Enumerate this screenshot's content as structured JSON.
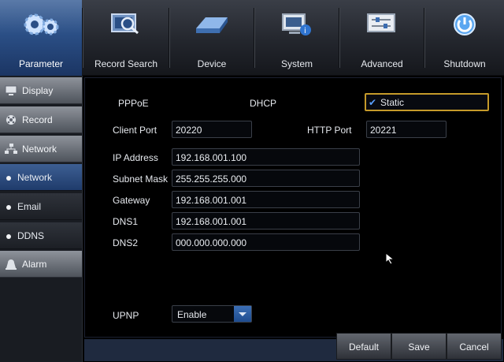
{
  "topnav": {
    "tabs": [
      {
        "label": "Parameter",
        "icon": "gear-icon",
        "active": true
      },
      {
        "label": "Record Search",
        "icon": "search-icon",
        "active": false
      },
      {
        "label": "Device",
        "icon": "hard-disk-icon",
        "active": false
      },
      {
        "label": "System",
        "icon": "system-info-icon",
        "active": false
      },
      {
        "label": "Advanced",
        "icon": "sliders-icon",
        "active": false
      },
      {
        "label": "Shutdown",
        "icon": "power-icon",
        "active": false
      }
    ]
  },
  "sidebar": {
    "items": [
      {
        "label": "Display",
        "type": "group",
        "icon": "monitor-icon"
      },
      {
        "label": "Record",
        "type": "group",
        "icon": "film-reel-icon"
      },
      {
        "label": "Network",
        "type": "group",
        "icon": "network-icon"
      },
      {
        "label": "Network",
        "type": "sub",
        "active": true
      },
      {
        "label": "Email",
        "type": "sub"
      },
      {
        "label": "DDNS",
        "type": "sub"
      },
      {
        "label": "Alarm",
        "type": "group",
        "icon": "alarm-icon"
      }
    ]
  },
  "network": {
    "modes": {
      "pppoe": "PPPoE",
      "dhcp": "DHCP",
      "static": "Static",
      "selected": "Static"
    },
    "client_port_label": "Client Port",
    "client_port": "20220",
    "http_port_label": "HTTP Port",
    "http_port": "20221",
    "ip_label": "IP Address",
    "ip": "192.168.001.100",
    "subnet_label": "Subnet Mask",
    "subnet": "255.255.255.000",
    "gateway_label": "Gateway",
    "gateway": "192.168.001.001",
    "dns1_label": "DNS1",
    "dns1": "192.168.001.001",
    "dns2_label": "DNS2",
    "dns2": "000.000.000.000",
    "upnp_label": "UPNP",
    "upnp": "Enable"
  },
  "buttons": {
    "default": "Default",
    "save": "Save",
    "cancel": "Cancel"
  },
  "colors": {
    "accent_blue": "#2b4f86",
    "selection_border": "#c59a2a",
    "check": "#5aa0ff"
  }
}
